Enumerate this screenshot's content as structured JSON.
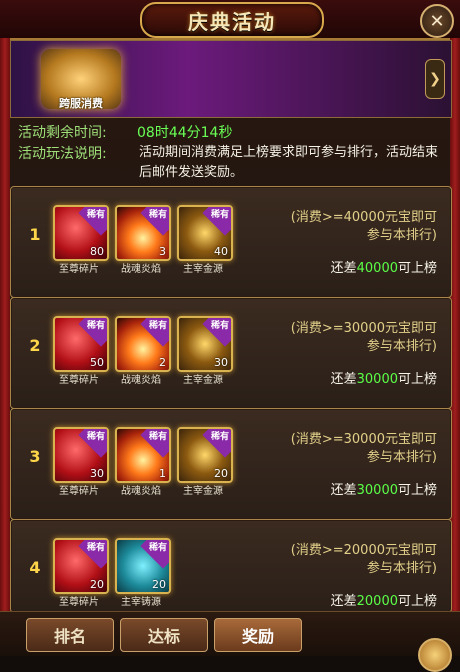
{
  "title": "庆典活动",
  "banner": {
    "logo_text": "跨服消费",
    "arrow": "❯"
  },
  "info": {
    "time_label": "活动剩余时间:",
    "time_value": "08时44分14秒",
    "rules_label": "活动玩法说明:",
    "rules_text": "活动期间消费满足上榜要求即可参与排行，活动结束后邮件发送奖励。"
  },
  "badge": "稀有",
  "rows": [
    {
      "rank": "1",
      "items": [
        {
          "name": "至尊碎片",
          "qty": "80",
          "type": "gem"
        },
        {
          "name": "战魂炎焰",
          "qty": "3",
          "type": "flame"
        },
        {
          "name": "主宰金源",
          "qty": "40",
          "type": "coin"
        }
      ],
      "req": "(消费>=40000元宝即可参与本排行)",
      "diff_prefix": "还差",
      "diff_value": "40000",
      "diff_suffix": "可上榜"
    },
    {
      "rank": "2",
      "items": [
        {
          "name": "至尊碎片",
          "qty": "50",
          "type": "gem"
        },
        {
          "name": "战魂炎焰",
          "qty": "2",
          "type": "flame"
        },
        {
          "name": "主宰金源",
          "qty": "30",
          "type": "coin"
        }
      ],
      "req": "(消费>=30000元宝即可参与本排行)",
      "diff_prefix": "还差",
      "diff_value": "30000",
      "diff_suffix": "可上榜"
    },
    {
      "rank": "3",
      "items": [
        {
          "name": "至尊碎片",
          "qty": "30",
          "type": "gem"
        },
        {
          "name": "战魂炎焰",
          "qty": "1",
          "type": "flame"
        },
        {
          "name": "主宰金源",
          "qty": "20",
          "type": "coin"
        }
      ],
      "req": "(消费>=30000元宝即可参与本排行)",
      "diff_prefix": "还差",
      "diff_value": "30000",
      "diff_suffix": "可上榜"
    },
    {
      "rank": "4",
      "items": [
        {
          "name": "至尊碎片",
          "qty": "20",
          "type": "gem"
        },
        {
          "name": "主宰铸源",
          "qty": "20",
          "type": "coin-blue"
        }
      ],
      "req": "(消费>=20000元宝即可参与本排行)",
      "diff_prefix": "还差",
      "diff_value": "20000",
      "diff_suffix": "可上榜"
    }
  ],
  "tabs": [
    {
      "label": "排名"
    },
    {
      "label": "达标"
    },
    {
      "label": "奖励"
    }
  ]
}
